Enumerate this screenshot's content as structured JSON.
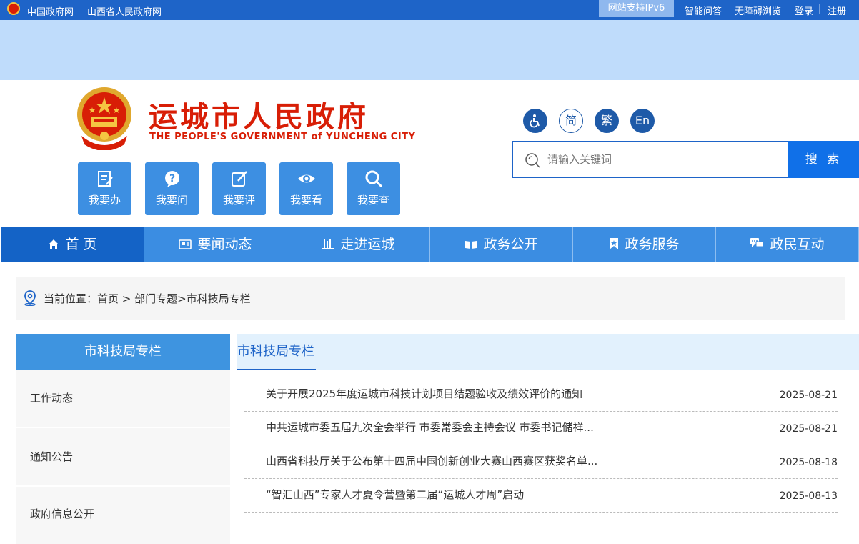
{
  "topbar": {
    "links": [
      "中国政府网",
      "山西省人民政府网"
    ],
    "ipv6": "网站支持IPv6",
    "right": [
      "智能问答",
      "无障碍浏览",
      "登录",
      "注册"
    ],
    "sep": "|"
  },
  "header": {
    "title": "运城市人民政府",
    "subtitle": "THE PEOPLE'S GOVERNMENT of YUNCHENG  CITY"
  },
  "quick_buttons": [
    {
      "label": "我要办",
      "icon": "form-edit-icon"
    },
    {
      "label": "我要问",
      "icon": "question-bubble-icon"
    },
    {
      "label": "我要评",
      "icon": "pencil-note-icon"
    },
    {
      "label": "我要看",
      "icon": "eye-icon"
    },
    {
      "label": "我要查",
      "icon": "search-icon"
    }
  ],
  "lang": {
    "simplified": "简",
    "traditional": "繁",
    "english": "En"
  },
  "search": {
    "placeholder": "请输入关键词",
    "button": "搜 索"
  },
  "nav": [
    {
      "label": "首 页",
      "icon": "home-icon"
    },
    {
      "label": "要闻动态",
      "icon": "newspaper-icon"
    },
    {
      "label": "走进运城",
      "icon": "building-icon"
    },
    {
      "label": "政务公开",
      "icon": "open-book-icon"
    },
    {
      "label": "政务服务",
      "icon": "bookmark-icon"
    },
    {
      "label": "政民互动",
      "icon": "chat-icon"
    }
  ],
  "breadcrumb": {
    "text": "当前位置：首页 > 部门专题>市科技局专栏"
  },
  "sidebar": {
    "title": "市科技局专栏",
    "items": [
      "工作动态",
      "通知公告",
      "政府信息公开"
    ]
  },
  "main": {
    "tab": "市科技局专栏",
    "news": [
      {
        "title": "关于开展2025年度运城市科技计划项目结题验收及绩效评价的通知",
        "date": "2025-08-21"
      },
      {
        "title": "中共运城市委五届九次全会举行 市委常委会主持会议 市委书记储祥...",
        "date": "2025-08-21"
      },
      {
        "title": "山西省科技厅关于公布第十四届中国创新创业大赛山西赛区获奖名单...",
        "date": "2025-08-18"
      },
      {
        "title": "“智汇山西”专家人才夏令营暨第二届“运城人才周”启动",
        "date": "2025-08-13"
      }
    ]
  },
  "colors": {
    "primary": "#1e64c8",
    "nav": "#3b8de2",
    "title_red": "#d81e06",
    "band": "#bfdcfb"
  }
}
